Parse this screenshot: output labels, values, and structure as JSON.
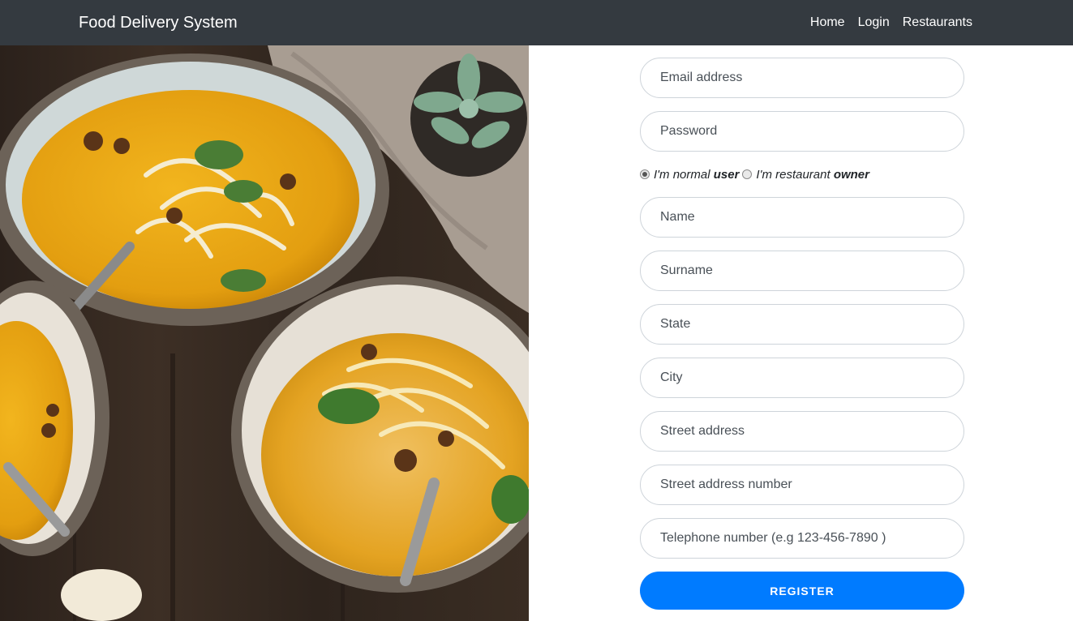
{
  "navbar": {
    "brand": "Food Delivery System",
    "links": [
      {
        "label": "Home"
      },
      {
        "label": "Login"
      },
      {
        "label": "Restaurants"
      }
    ]
  },
  "form": {
    "email_placeholder": "Email address",
    "password_placeholder": "Password",
    "role_options": [
      {
        "prefix": "I'm normal",
        "bold": "user",
        "checked": true
      },
      {
        "prefix": "I'm restaurant",
        "bold": "owner",
        "checked": false
      }
    ],
    "name_placeholder": "Name",
    "surname_placeholder": "Surname",
    "state_placeholder": "State",
    "city_placeholder": "City",
    "street_placeholder": "Street address",
    "street_number_placeholder": "Street address number",
    "telephone_placeholder": "Telephone number (e.g 123-456-7890 )",
    "register_label": "REGISTER"
  },
  "colors": {
    "navbar_bg": "#343a40",
    "primary": "#007bff",
    "soup": "#e8a516"
  }
}
